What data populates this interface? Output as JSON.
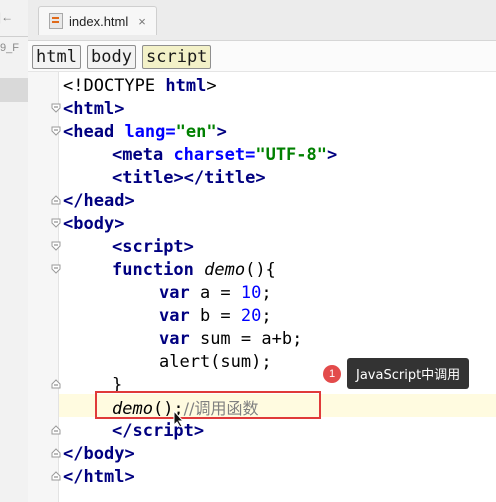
{
  "left_panel": {
    "title": "9_F",
    "collapse_label": "|←"
  },
  "tab": {
    "label": "index.html",
    "close": "×"
  },
  "breadcrumb": [
    "html",
    "body",
    "script"
  ],
  "code": {
    "l1a": "<!DOCTYPE ",
    "l1b": "html",
    "l1c": ">",
    "l2a": "<",
    "l2b": "html",
    "l2c": ">",
    "l3a": "<",
    "l3b": "head ",
    "l3c": "lang",
    "l3d": "=",
    "l3e": "\"en\"",
    "l3f": ">",
    "l4a": "<",
    "l4b": "meta ",
    "l4c": "charset",
    "l4d": "=",
    "l4e": "\"UTF-8\"",
    "l4f": ">",
    "l5a": "<",
    "l5b": "title",
    "l5c": "></",
    "l5d": "title",
    "l5e": ">",
    "l6a": "</",
    "l6b": "head",
    "l6c": ">",
    "l7a": "<",
    "l7b": "body",
    "l7c": ">",
    "l8a": "<",
    "l8b": "script",
    "l8c": ">",
    "l9a": "function ",
    "l9b": "demo",
    "l9c": "(){",
    "l10a": "var ",
    "l10b": "a = ",
    "l10c": "10",
    "l10d": ";",
    "l11a": "var ",
    "l11b": "b = ",
    "l11c": "20",
    "l11d": ";",
    "l12a": "var ",
    "l12b": "sum = a+b;",
    "l13": "alert(sum);",
    "l14": "}",
    "l15a": "demo",
    "l15b": "();",
    "l15c": "//调用函数",
    "l16a": "</",
    "l16b": "script",
    "l16c": ">",
    "l17a": "</",
    "l17b": "body",
    "l17c": ">",
    "l18a": "</",
    "l18b": "html",
    "l18c": ">"
  },
  "annotation": {
    "badge_number": "1",
    "label": "JavaScript中调用"
  },
  "colors": {
    "highlight_border": "#e03a3a",
    "badge": "#e34b4b",
    "tooltip_bg": "#333333",
    "tag": "#000080",
    "attr": "#0000ff",
    "string": "#008000",
    "comment": "#808080"
  }
}
